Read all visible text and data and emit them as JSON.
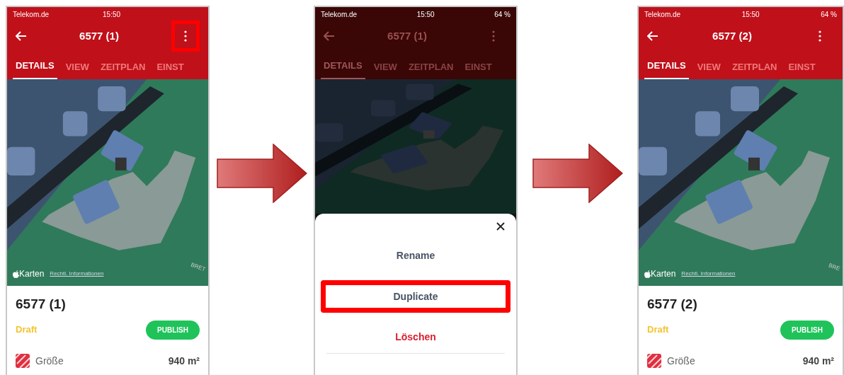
{
  "screens": [
    {
      "status": {
        "carrier": "Telekom.de",
        "time": "15:50"
      },
      "title": "6577 (1)",
      "menu_highlighted": true,
      "dimmed": false,
      "tabs": [
        {
          "label": "DETAILS",
          "selected": true
        },
        {
          "label": "VIEW",
          "selected": false
        },
        {
          "label": "ZEITPLAN",
          "selected": false
        },
        {
          "label": "EINST",
          "selected": false
        }
      ],
      "map": {
        "brand": "Karten",
        "legal": "Rechtl. Informationen",
        "street": "BRET"
      },
      "details": {
        "name": "6577 (1)",
        "status": "Draft",
        "action": "PUBLISH",
        "area_label": "Größe",
        "area_value": "940 m²"
      }
    },
    {
      "status": {
        "carrier": "Telekom.de",
        "time": "15:50",
        "battery": "64 %"
      },
      "title": "6577 (1)",
      "menu_highlighted": false,
      "dimmed": true,
      "tabs": [
        {
          "label": "DETAILS",
          "selected": true
        },
        {
          "label": "VIEW",
          "selected": false
        },
        {
          "label": "ZEITPLAN",
          "selected": false
        },
        {
          "label": "EINST",
          "selected": false
        }
      ],
      "sheet": {
        "items": [
          {
            "label": "Rename",
            "kind": "normal",
            "highlighted": false
          },
          {
            "label": "Duplicate",
            "kind": "normal",
            "highlighted": true
          },
          {
            "label": "Löschen",
            "kind": "danger",
            "highlighted": false
          }
        ]
      }
    },
    {
      "status": {
        "carrier": "Telekom.de",
        "time": "15:50",
        "battery": "64 %"
      },
      "title": "6577 (2)",
      "menu_highlighted": false,
      "dimmed": false,
      "tabs": [
        {
          "label": "DETAILS",
          "selected": true
        },
        {
          "label": "VIEW",
          "selected": false
        },
        {
          "label": "ZEITPLAN",
          "selected": false
        },
        {
          "label": "EINST",
          "selected": false
        }
      ],
      "map": {
        "brand": "Karten",
        "legal": "Rechtl. Informationen",
        "street": "BRE"
      },
      "details": {
        "name": "6577 (2)",
        "status": "Draft",
        "action": "PUBLISH",
        "area_label": "Größe",
        "area_value": "940 m²"
      }
    }
  ]
}
